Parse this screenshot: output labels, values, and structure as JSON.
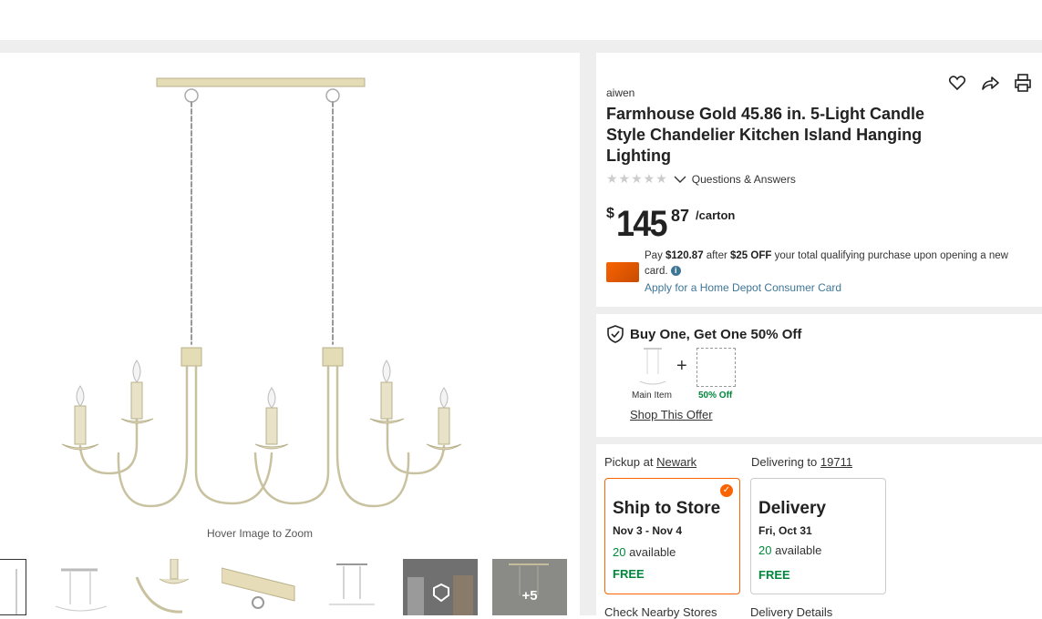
{
  "gallery": {
    "zoom_hint": "Hover Image to Zoom",
    "more_thumbs": "+5"
  },
  "product": {
    "brand": "aiwen",
    "title": "Farmhouse Gold 45.86 in. 5-Light Candle Style Chandelier Kitchen Island Hanging Lighting",
    "stars": "★★★★★",
    "rating_value": 0,
    "qa_label": "Questions & Answers",
    "price": {
      "currency": "$",
      "dollars": "145",
      "cents": "87",
      "unit": "/carton"
    }
  },
  "promo": {
    "pay_prefix": "Pay ",
    "pay_amount": "$120.87",
    "after": " after ",
    "discount": "$25 OFF",
    "rest": " your total qualifying purchase upon opening a new card.",
    "info_icon": "i",
    "apply_link": "Apply for a Home Depot Consumer Card"
  },
  "bogo": {
    "title": "Buy One, Get One 50% Off",
    "plus": "+",
    "main_item_label": "Main Item",
    "off_label": "50% Off",
    "shop_link": "Shop This Offer"
  },
  "fulfillment": {
    "pickup_prefix": "Pickup at ",
    "pickup_store": "Newark",
    "delivering_prefix": "Delivering to ",
    "delivering_zip": "19711",
    "ship": {
      "title": "Ship to Store",
      "dates": "Nov 3 - Nov 4",
      "count": "20",
      "available": " available",
      "cost": "FREE",
      "check": "✓"
    },
    "delivery": {
      "title": "Delivery",
      "date": "Fri, Oct 31",
      "count": "20",
      "available": " available",
      "cost": "FREE"
    },
    "nearby_link": "Check Nearby Stores",
    "details_link": "Delivery Details"
  },
  "colors": {
    "accent": "#f96302",
    "green": "#00873c",
    "link": "#3e7697",
    "fixture": "#c8c2a0"
  }
}
